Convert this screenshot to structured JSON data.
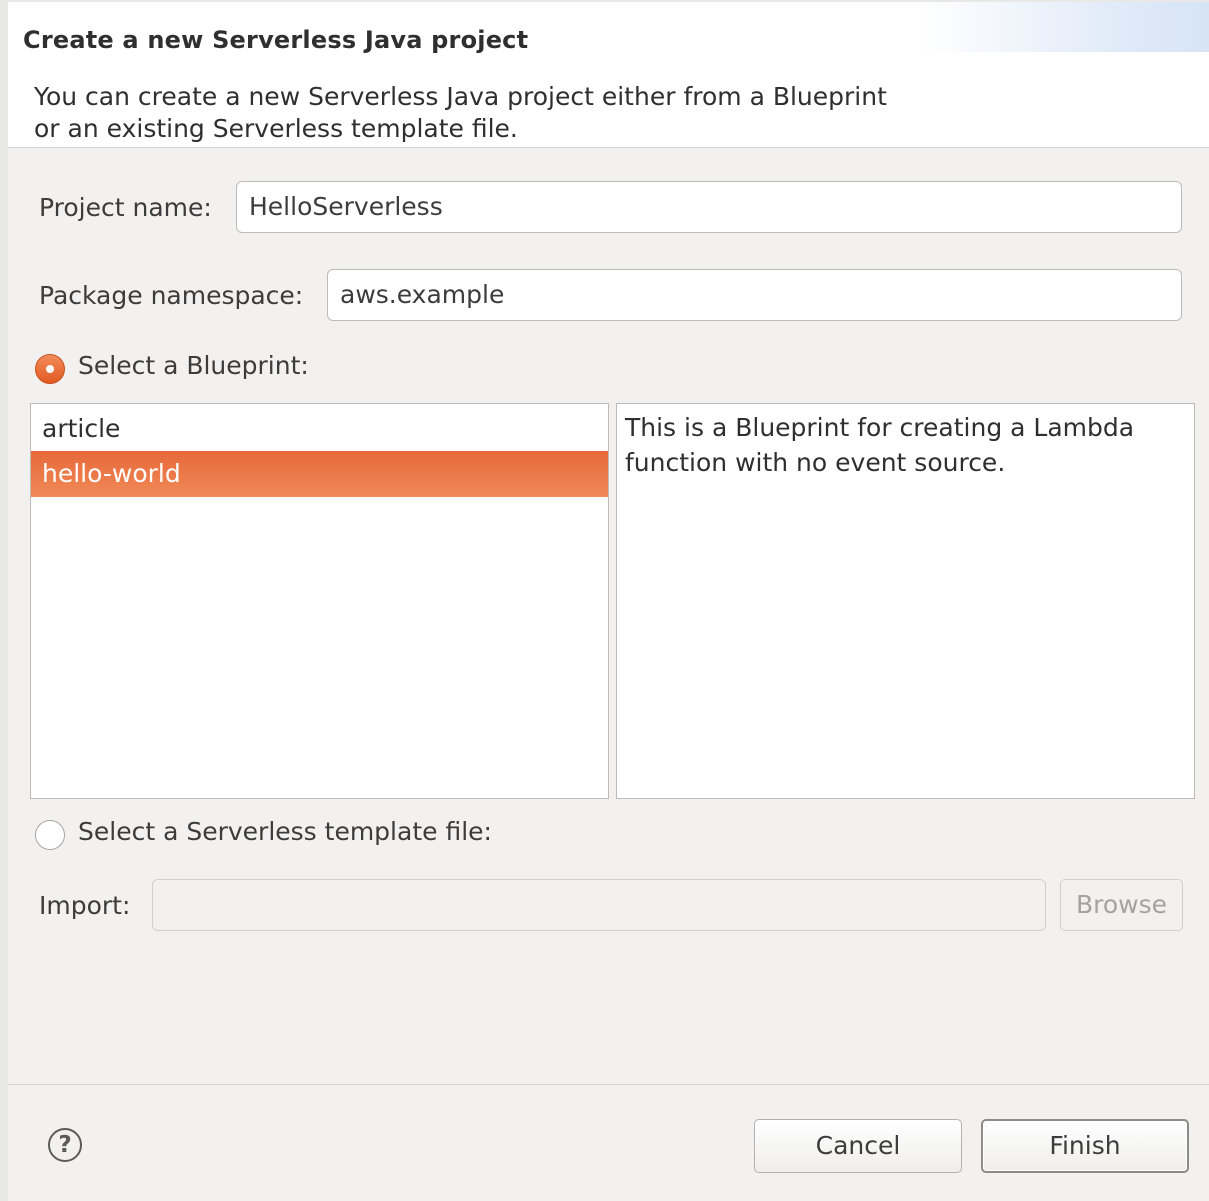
{
  "header": {
    "title": "Create a new Serverless Java project",
    "description_line1": "You can create a new Serverless Java project either from a Blueprint",
    "description_line2": "or an existing Serverless template file."
  },
  "form": {
    "project_name_label": "Project name:",
    "project_name_value": "HelloServerless",
    "package_namespace_label": "Package namespace:",
    "package_namespace_value": "aws.example",
    "blueprint_radio_label": "Select a Blueprint:",
    "blueprint_radio_checked": true,
    "blueprints": [
      {
        "label": "article",
        "selected": false
      },
      {
        "label": "hello-world",
        "selected": true
      }
    ],
    "blueprint_description": "This is a Blueprint for creating a Lambda function with no event source.",
    "template_radio_label": "Select a Serverless template file:",
    "template_radio_checked": false,
    "import_label": "Import:",
    "import_value": "",
    "browse_label": "Browse"
  },
  "footer": {
    "help_icon": "help-icon",
    "help_glyph": "?",
    "cancel_label": "Cancel",
    "finish_label": "Finish"
  },
  "colors": {
    "accent": "#e95420",
    "selection": "#ec7440"
  }
}
